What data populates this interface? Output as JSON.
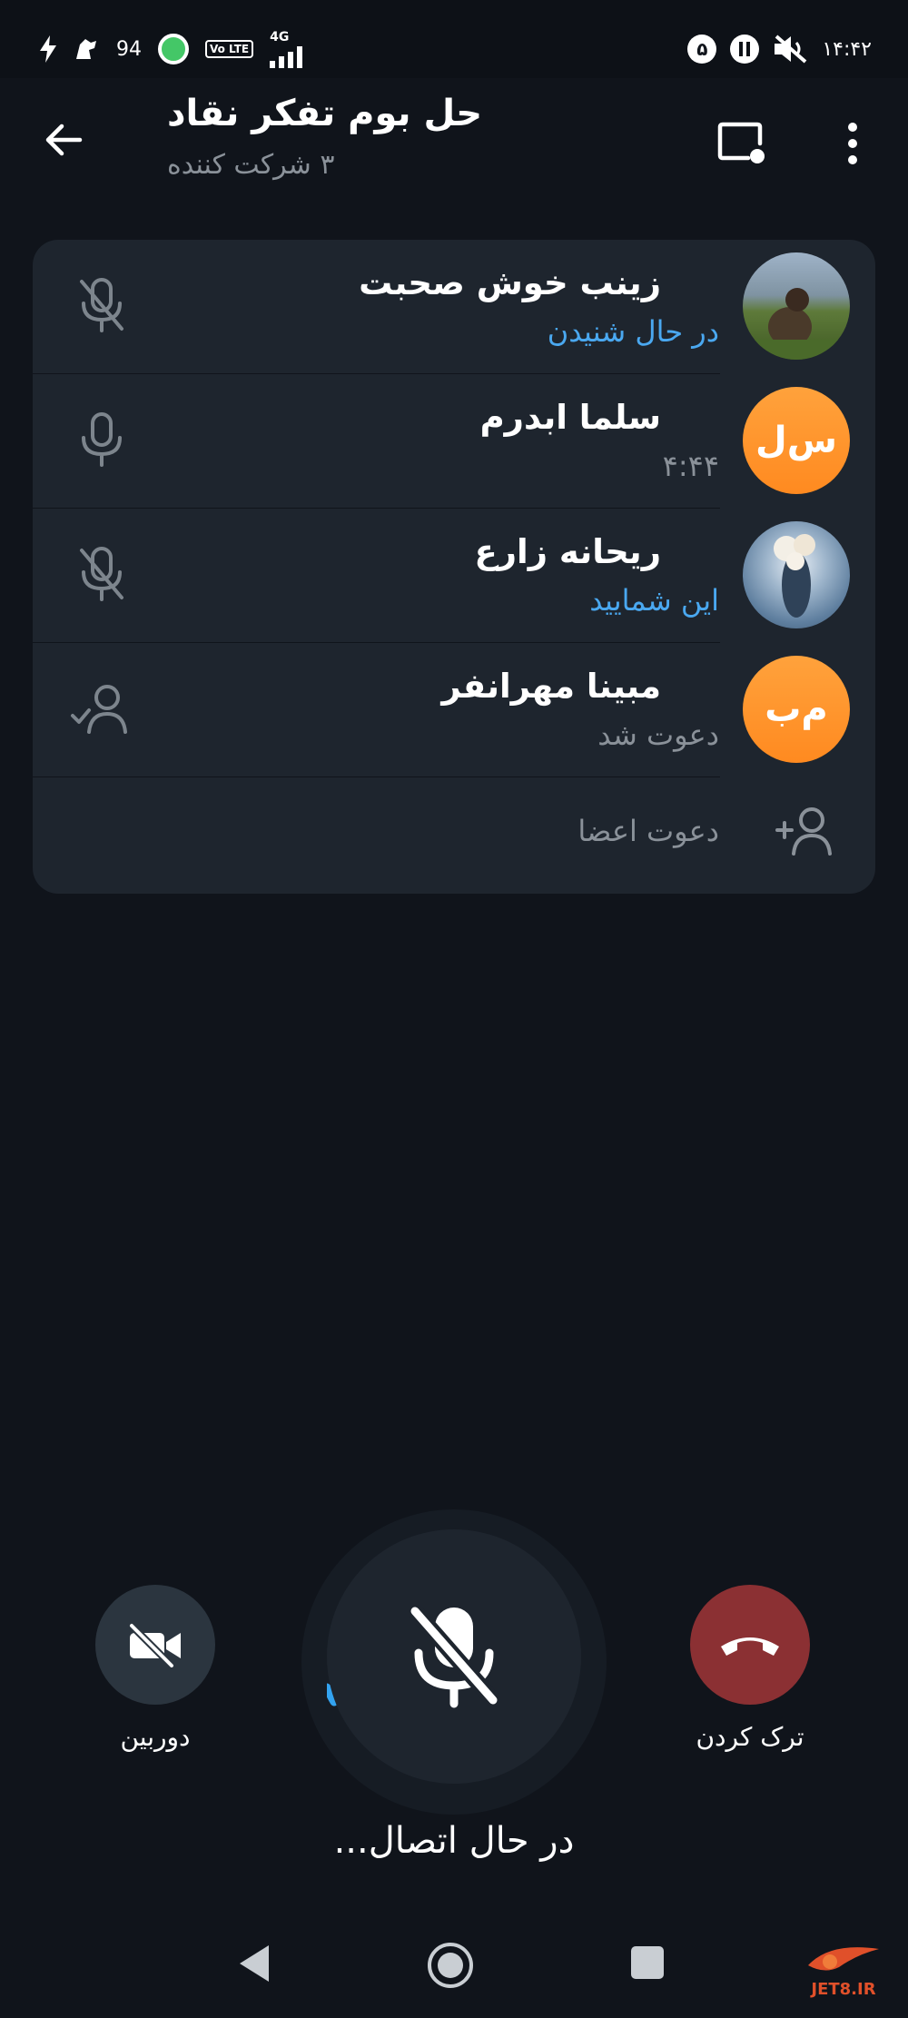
{
  "status_bar": {
    "battery": "94",
    "network": "4G",
    "volte": "Vo LTE",
    "notification_count": "۵",
    "time": "۱۴:۴۲"
  },
  "header": {
    "title": "حل بوم تفکر نقاد",
    "subtitle": "۳ شرکت کننده"
  },
  "participants": [
    {
      "name": "زینب خوش صحبت",
      "status": "در حال شنیدن",
      "status_color": "#4aa8f0",
      "avatar": "photo-person-field",
      "mic": "mic-off-icon"
    },
    {
      "name": "سلما ابدرم",
      "status": "۴:۴۴",
      "status_color": "#8a9199",
      "avatar_initials": "س‌ل",
      "mic": "mic-icon"
    },
    {
      "name": "ریحانه زارع",
      "status": "این شمایید",
      "status_color": "#4aa8f0",
      "avatar": "photo-cloud-figure",
      "mic": "mic-off-icon"
    },
    {
      "name": "مبینا مهرانفر",
      "status": "دعوت شد",
      "status_color": "#8a9199",
      "avatar_initials": "م‌ب",
      "mic": "user-check-icon"
    }
  ],
  "invite": {
    "label": "دعوت اعضا"
  },
  "controls": {
    "camera_label": "دوربین",
    "leave_label": "ترک کردن",
    "connecting_text": "در حال اتصال...",
    "leave_color": "#8b3033",
    "camera_bg": "#2b353f"
  },
  "watermark": "JET8.IR"
}
